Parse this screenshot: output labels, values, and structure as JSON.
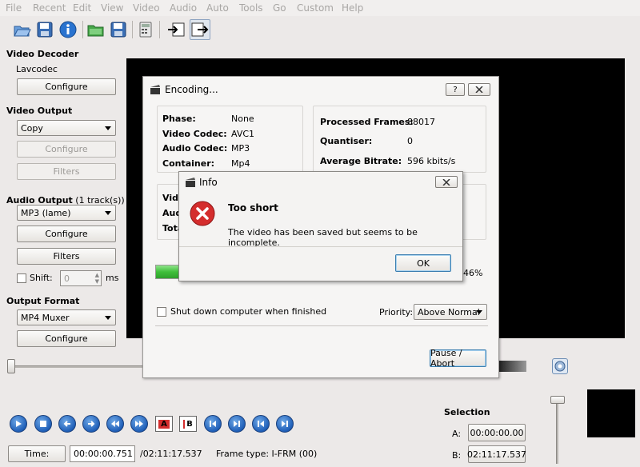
{
  "menubar": [
    "File",
    "Recent",
    "Edit",
    "View",
    "Video",
    "Audio",
    "Auto",
    "Tools",
    "Go",
    "Custom",
    "Help"
  ],
  "toolbar_icons": [
    "open-icon",
    "save-icon",
    "info-icon",
    "open-folder-icon",
    "save-folder-icon",
    "calculator-icon",
    "input-icon",
    "output-icon"
  ],
  "left": {
    "video_decoder": {
      "title": "Video Decoder",
      "decoder": "Lavcodec",
      "configure": "Configure"
    },
    "video_output": {
      "title": "Video Output",
      "codec": "Copy",
      "configure": "Configure",
      "filters": "Filters"
    },
    "audio_output": {
      "title": "Audio Output",
      "tracks": "(1 track(s))",
      "codec": "MP3 (lame)",
      "configure": "Configure",
      "filters": "Filters",
      "shift_label": "Shift:",
      "shift_value": "0",
      "shift_unit": "ms"
    },
    "output_format": {
      "title": "Output Format",
      "muxer": "MP4 Muxer",
      "configure": "Configure"
    }
  },
  "encoding": {
    "title": "Encoding...",
    "help": "?",
    "phase_label": "Phase:",
    "phase": "None",
    "vcodec_label": "Video Codec:",
    "vcodec": "AVC1",
    "acodec_label": "Audio Codec:",
    "acodec": "MP3",
    "container_label": "Container:",
    "container": "Mp4",
    "frames_label": "Processed Frames:",
    "frames": "88017",
    "quantiser_label": "Quantiser:",
    "quantiser": "0",
    "bitrate_label": "Average Bitrate:",
    "bitrate": "596 kbits/s",
    "partial_1": "Vide",
    "partial_2": "Audi",
    "partial_3": "Tota",
    "progress_text": "46%",
    "progress": 0.46,
    "shutdown_label": "Shut down computer when finished",
    "priority_label": "Priority:",
    "priority": "Above Normal",
    "pause_abort": "Pause / Abort"
  },
  "info": {
    "title": "Info",
    "heading": "Too short",
    "message": "The video has been saved but seems to be incomplete.",
    "ok": "OK"
  },
  "bottom": {
    "time_button": "Time:",
    "time": "00:00:00.751",
    "total": "/02:11:17.537",
    "frame_type": "Frame type:  I-FRM (00)",
    "selection_title": "Selection",
    "a_label": "A:",
    "a_value": "00:00:00.00",
    "b_label": "B:",
    "b_value": "02:11:17.537"
  },
  "colors": {
    "progress": "#3fbf3a",
    "accent": "#2a6fc9",
    "error": "#d42d2d"
  }
}
